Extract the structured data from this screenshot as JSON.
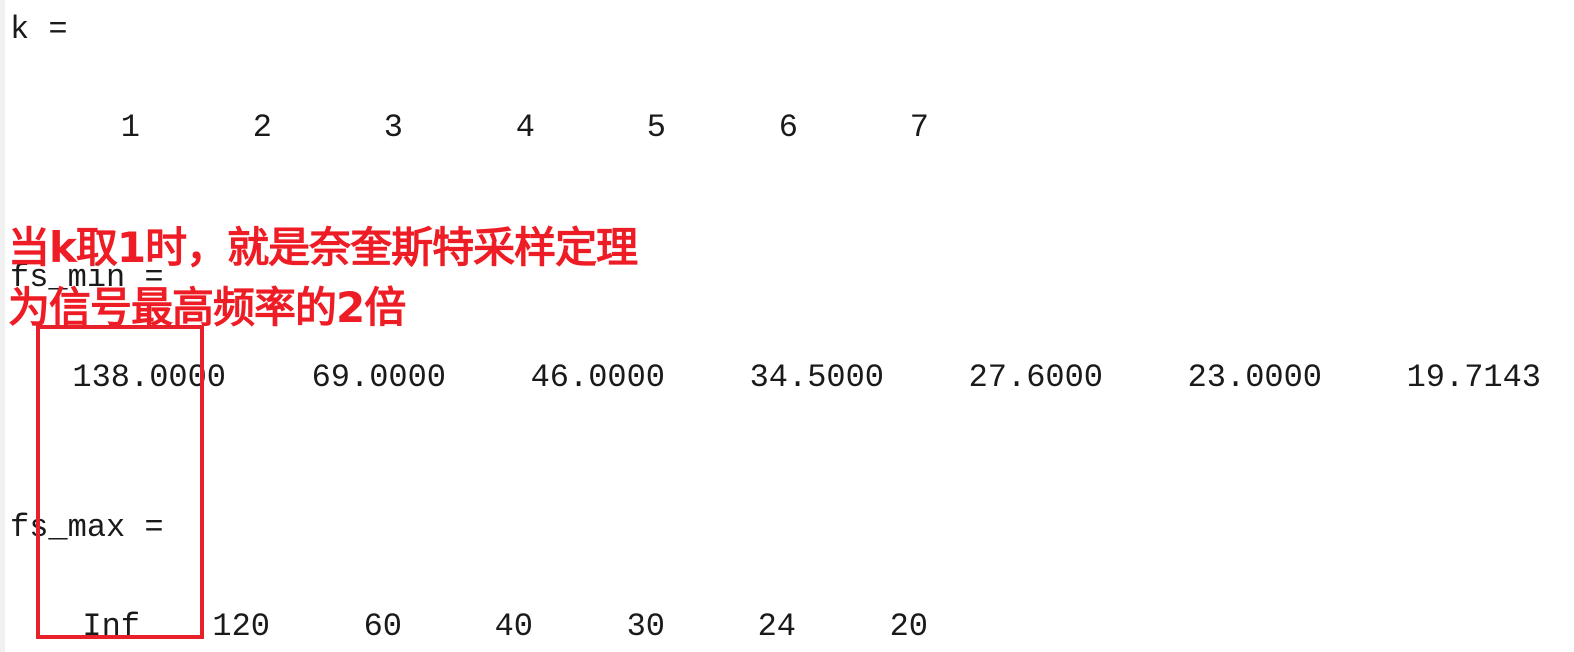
{
  "k_section": {
    "label": "k =",
    "values": [
      "1",
      "2",
      "3",
      "4",
      "5",
      "6",
      "7"
    ]
  },
  "fs_min_section": {
    "label": "fs_min =",
    "values": [
      "138.0000",
      "69.0000",
      "46.0000",
      "34.5000",
      "27.6000",
      "23.0000",
      "19.7143"
    ]
  },
  "fs_max_section": {
    "label": "fs_max =",
    "values": [
      "Inf",
      "120",
      "60",
      "40",
      "30",
      "24",
      "20"
    ]
  },
  "annotation": {
    "line1": "当k取1时，就是奈奎斯特采样定理",
    "line2": "为信号最高频率的2倍",
    "color": "#ee1c25"
  }
}
